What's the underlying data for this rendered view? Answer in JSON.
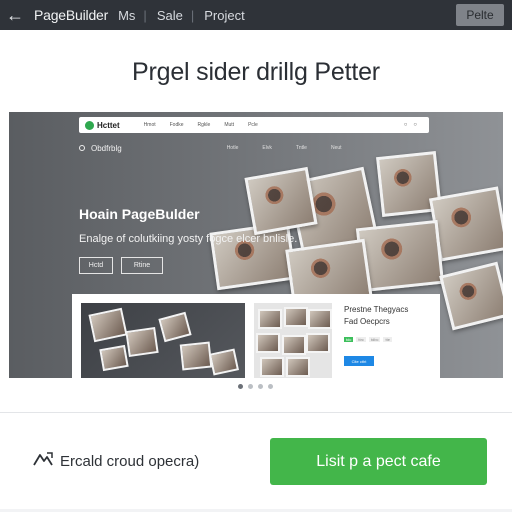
{
  "topbar": {
    "app_name": "PageBuilder",
    "nav": [
      "Ms",
      "Sale",
      "Project"
    ],
    "action_label": "Pelte"
  },
  "headline": "Prgel sider drillg Petter",
  "preview": {
    "mini_nav": {
      "brand": "Hcttet",
      "links": [
        "Hmot",
        "Fodke",
        "Rgkle",
        "Mutt",
        "Pcle"
      ]
    },
    "sub_nav": {
      "brand": "Obdfrblg",
      "links": [
        "Hotle",
        "Elvk",
        "Tntle",
        "Neut"
      ]
    },
    "hero_title": "Hoain PageBulder",
    "hero_subtitle": "Enalge of colutkiing yosty fogce elcer bnlisle.",
    "hero_buttons": [
      "Hctd",
      "Rtine"
    ],
    "card": {
      "title_line1": "Prestne Thegyacs",
      "title_line2": "Fad Oecpcrs",
      "tags": [
        "tdc",
        "ttrc",
        "tdbc",
        "tte"
      ],
      "button_label": "Clte ctht"
    },
    "pager_count": 4,
    "pager_active": 0
  },
  "footer": {
    "icon": "cloud-arrow-icon",
    "text": "Ercald croud opecra)",
    "cta_label": "Lisit p a pect cafe"
  },
  "colors": {
    "topbar_bg": "#2f3339",
    "cta_green": "#43b64a",
    "headline_text": "#2b2f35"
  }
}
